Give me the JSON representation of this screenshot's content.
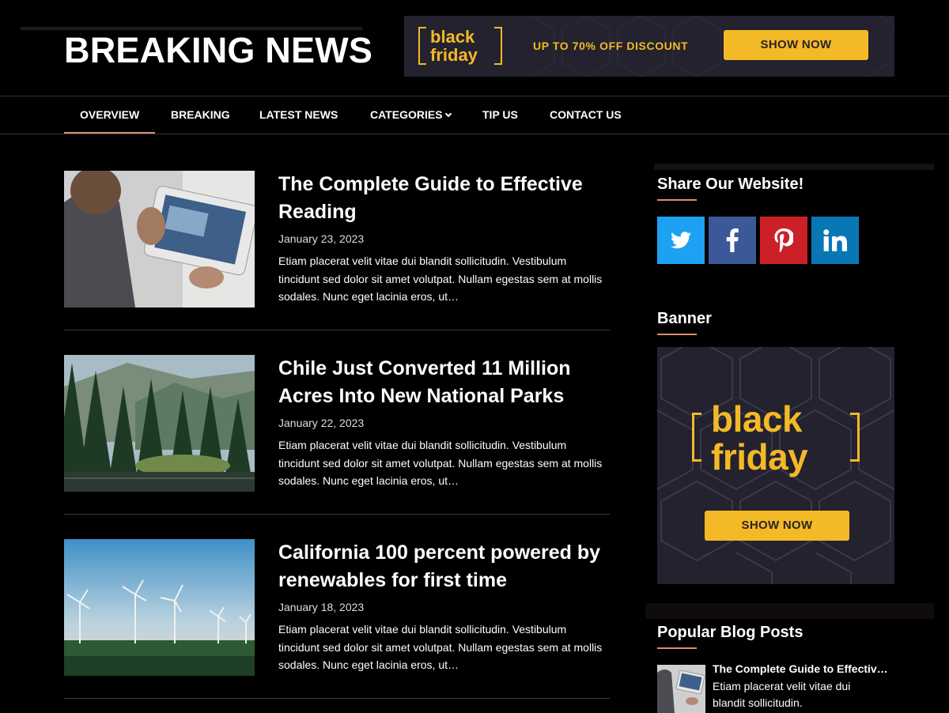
{
  "header": {
    "site_title": "BREAKING NEWS",
    "banner": {
      "word1": "black",
      "word2": "friday",
      "discount": "UP TO 70% OFF DISCOUNT",
      "button": "SHOW NOW"
    }
  },
  "nav": {
    "items": [
      {
        "label": "OVERVIEW",
        "active": true
      },
      {
        "label": "BREAKING"
      },
      {
        "label": "LATEST NEWS"
      },
      {
        "label": "CATEGORIES",
        "dropdown": true
      },
      {
        "label": "TIP US"
      },
      {
        "label": "CONTACT US"
      }
    ]
  },
  "posts": [
    {
      "title": "The Complete Guide to Effective Reading",
      "date": "January 23, 2023",
      "excerpt": "Etiam placerat velit vitae dui blandit sollicitudin. Vestibulum tincidunt sed dolor sit amet volutpat. Nullam egestas sem at mollis sodales. Nunc eget lacinia eros, ut…"
    },
    {
      "title": "Chile Just Converted 11 Million Acres Into New National Parks",
      "date": "January 22, 2023",
      "excerpt": "Etiam placerat velit vitae dui blandit sollicitudin. Vestibulum tincidunt sed dolor sit amet volutpat. Nullam egestas sem at mollis sodales. Nunc eget lacinia eros, ut…"
    },
    {
      "title": "California 100 percent powered by renewables for first time",
      "date": "January 18, 2023",
      "excerpt": "Etiam placerat velit vitae dui blandit sollicitudin. Vestibulum tincidunt sed dolor sit amet volutpat. Nullam egestas sem at mollis sodales. Nunc eget lacinia eros, ut…"
    }
  ],
  "sidebar": {
    "share_title": "Share Our Website!",
    "share_buttons": [
      {
        "name": "twitter",
        "color": "#1da1f2"
      },
      {
        "name": "facebook",
        "color": "#3b5998"
      },
      {
        "name": "pinterest",
        "color": "#cb2027"
      },
      {
        "name": "linkedin",
        "color": "#0a77b5"
      }
    ],
    "banner_title": "Banner",
    "banner": {
      "word1": "black",
      "word2": "friday",
      "button": "SHOW NOW"
    },
    "popular_title": "Popular Blog Posts",
    "popular_posts": [
      {
        "title": "The Complete Guide to Effectiv…",
        "excerpt": "Etiam placerat velit vitae dui blandit sollicitudin."
      }
    ]
  },
  "colors": {
    "accent": "#d9906d",
    "banner_yellow": "#f4b927",
    "banner_bg": "#23222e"
  }
}
